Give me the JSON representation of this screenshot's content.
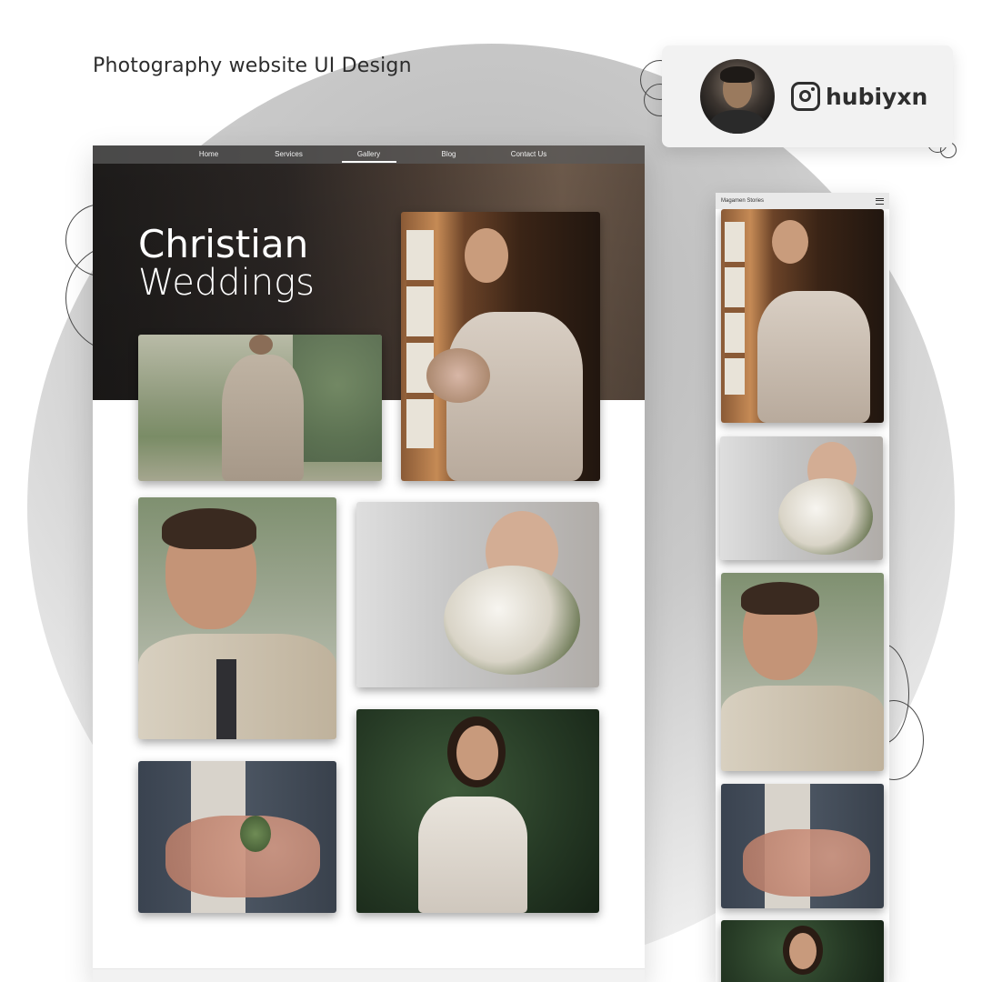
{
  "headline": "Photography website UI Design",
  "profile": {
    "handle": "hubiyxn",
    "avatar_icon": "avatar-photo",
    "social_icon": "instagram-icon"
  },
  "desktop": {
    "nav": [
      {
        "label": "Home",
        "active": false
      },
      {
        "label": "Services",
        "active": false
      },
      {
        "label": "Gallery",
        "active": true
      },
      {
        "label": "Blog",
        "active": false
      },
      {
        "label": "Contact Us",
        "active": false
      }
    ],
    "hero_title_line1": "Christian",
    "hero_title_line2": "Weddings",
    "gallery": [
      "groom-walking-garden-photo",
      "bride-window-bouquet-photo",
      "groom-emotional-photo",
      "bride-veil-flowers-photo",
      "groom-boutonniere-photo",
      "bride-smiling-outdoor-photo"
    ]
  },
  "mobile": {
    "brand": "Magamen Stories",
    "menu_icon": "hamburger-menu-icon",
    "gallery": [
      "bride-window-bouquet-photo",
      "bride-veil-flowers-photo",
      "groom-emotional-photo",
      "groom-boutonniere-photo",
      "bride-smiling-outdoor-photo"
    ]
  },
  "colors": {
    "hero_dark": "#1d1b1a",
    "accent_text": "#2e2e2e",
    "background_circle": "#c2c2c2"
  }
}
